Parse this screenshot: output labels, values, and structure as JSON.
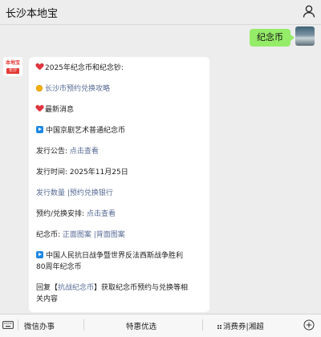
{
  "header": {
    "title": "长沙本地宝"
  },
  "chat": {
    "user_message": "纪念币",
    "bot_avatar": {
      "logo_text": "本地宝",
      "city_tag": "长沙"
    },
    "lines": [
      {
        "id": "l1",
        "icon": "heart",
        "text": "2025年纪念币和纪念钞:",
        "link": ""
      },
      {
        "id": "l2",
        "icon": "dot",
        "text": "",
        "link": "长沙市预约兑换攻略"
      },
      {
        "id": "l3",
        "icon": "heart",
        "text": "最新消息",
        "link": ""
      },
      {
        "id": "l4",
        "icon": "play",
        "text": "中国京剧艺术普通纪念币",
        "link": ""
      },
      {
        "id": "l5",
        "icon": "",
        "text": "发行公告: ",
        "link": "点击查看"
      },
      {
        "id": "l6",
        "icon": "",
        "text": "发行时间: 2025年11月25日",
        "link": ""
      },
      {
        "id": "l7",
        "icon": "",
        "text": "",
        "link": "发行数量 |预约兑换银行"
      },
      {
        "id": "l8",
        "icon": "",
        "text": "预约/兑换安排: ",
        "link": "点击查看"
      },
      {
        "id": "l9",
        "icon": "",
        "text": "纪念币: ",
        "link": "正面图案 |背面图案"
      },
      {
        "id": "l10a",
        "icon": "play",
        "text": "中国人民抗日战争暨世界反法西斯战争胜利",
        "link": ""
      },
      {
        "id": "l10b",
        "icon": "",
        "text": "80周年纪念币",
        "link": ""
      },
      {
        "id": "l11a",
        "icon": "",
        "text": "回复【",
        "link": "抗战纪念币",
        "suffix": "】获取纪念币预约与兑换等相"
      },
      {
        "id": "l11b",
        "icon": "",
        "text": "关内容",
        "link": ""
      }
    ]
  },
  "bottom_menu": {
    "items": [
      "微信办事",
      "特惠优选",
      "消费券|湘超"
    ],
    "keyboard_icon": "keyboard-icon",
    "more_icon": "more-icon"
  },
  "colors": {
    "user_bubble": "#95ec69",
    "link": "#576b95",
    "background": "#ededed"
  }
}
